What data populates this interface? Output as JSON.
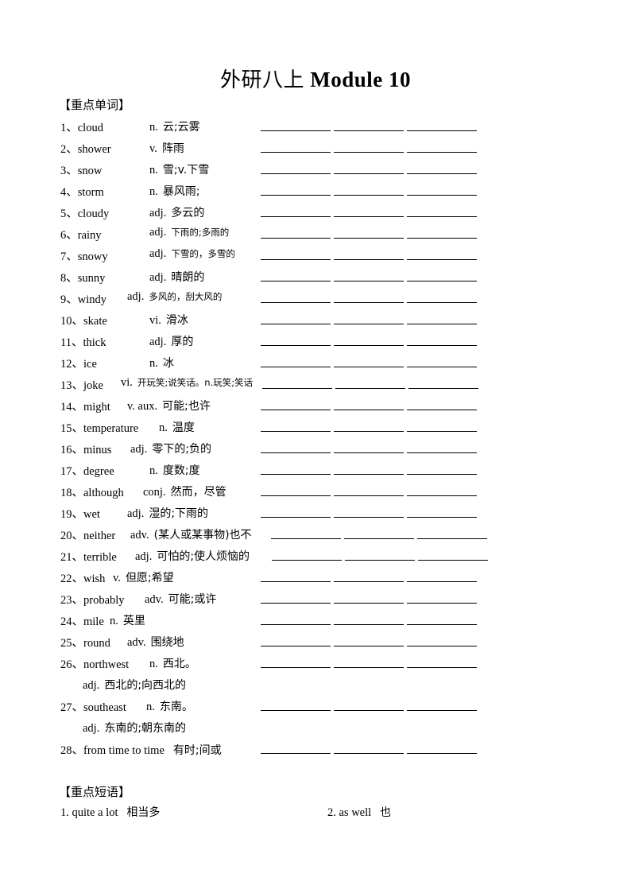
{
  "title": {
    "latin": "Module 10",
    "cn": "外研八上"
  },
  "sections": {
    "words": "【重点单词】",
    "phrases": "【重点短语】"
  },
  "words": [
    {
      "n": "1、",
      "w": "cloud",
      "p": "n.",
      "m": "云;云雾"
    },
    {
      "n": "2、",
      "w": "shower",
      "p": "v.",
      "m": "阵雨"
    },
    {
      "n": "3、",
      "w": "snow",
      "p": "n.",
      "m": "雪;v.下雪"
    },
    {
      "n": "4、",
      "w": "storm",
      "p": "n.",
      "m": "暴风雨;"
    },
    {
      "n": "5、",
      "w": "cloudy",
      "p": "adj.",
      "m": "多云的"
    },
    {
      "n": "6、",
      "w": "rainy",
      "p": "adj.",
      "m": "下雨的;多雨的"
    },
    {
      "n": "7、",
      "w": "snowy",
      "p": "adj.",
      "m": "下雪的，多雪的"
    },
    {
      "n": "8、",
      "w": "sunny",
      "p": "adj.",
      "m": "晴朗的"
    },
    {
      "n": "9、",
      "w": "windy",
      "p": "adj.",
      "m": "多风的，刮大风的"
    },
    {
      "n": "10、",
      "w": "skate",
      "p": "vi.",
      "m": "滑冰"
    },
    {
      "n": "11、",
      "w": "thick",
      "p": "adj.",
      "m": "厚的"
    },
    {
      "n": "12、",
      "w": "ice",
      "p": "n.",
      "m": "冰"
    },
    {
      "n": "13、",
      "w": "joke",
      "p": "vi.",
      "m": "开玩笑;说笑话。n.玩笑;笑话"
    },
    {
      "n": "14、",
      "w": "might",
      "p": "v.  aux.",
      "m": "可能;也许"
    },
    {
      "n": "15、",
      "w": "temperature",
      "p": "n.",
      "m": "温度"
    },
    {
      "n": "16、",
      "w": "minus",
      "p": "adj.",
      "m": "零下的;负的"
    },
    {
      "n": "17、",
      "w": "degree",
      "p": "n.",
      "m": "度数;度"
    },
    {
      "n": "18、",
      "w": "although",
      "p": "conj.",
      "m": "然而，尽管"
    },
    {
      "n": "19、",
      "w": "wet",
      "p": "adj.",
      "m": "湿的;下雨的"
    },
    {
      "n": "20、",
      "w": "neither",
      "p": "adv.",
      "m": "(某人或某事物)也不"
    },
    {
      "n": "21、",
      "w": "terrible",
      "p": "adj.",
      "m": "可怕的;使人烦恼的"
    },
    {
      "n": "22、",
      "w": "wish",
      "p": "v.",
      "m": "但愿;希望"
    },
    {
      "n": "23、",
      "w": "probably",
      "p": "adv.",
      "m": "可能;或许"
    },
    {
      "n": "24、",
      "w": "mile",
      "p": "n.",
      "m": "英里"
    },
    {
      "n": "25、",
      "w": "round",
      "p": "adv.",
      "m": "围绕地"
    },
    {
      "n": "26、",
      "w": "northwest",
      "p": "n.",
      "m": "西北。",
      "p2": "adj.",
      "m2": "西北的;向西北的"
    },
    {
      "n": "27、",
      "w": "southeast",
      "p": "n.",
      "m": "东南。",
      "p2": "adj.",
      "m2": "东南的;朝东南的"
    },
    {
      "n": "28、",
      "w": "from  time  to  time",
      "p": "",
      "m": "有时;间或"
    }
  ],
  "phrases": [
    {
      "en": "1. quite a lot",
      "cn": "相当多"
    },
    {
      "en": "2. as well",
      "cn": "也"
    }
  ]
}
